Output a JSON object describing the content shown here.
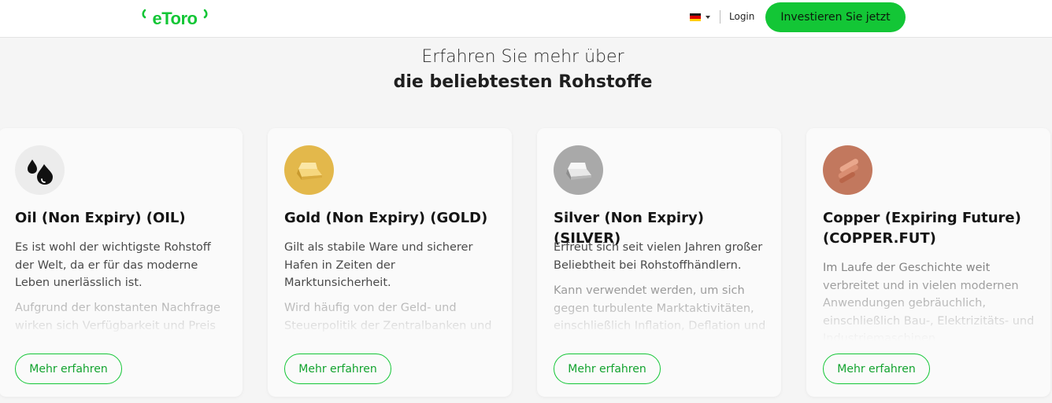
{
  "header": {
    "logo_text": "eToro",
    "language_flag": "de-flag",
    "login_label": "Login",
    "cta_label": "Investieren Sie jetzt",
    "accent_color": "#13c636"
  },
  "section": {
    "heading_line1": "Erfahren Sie mehr über",
    "heading_line2": "die beliebtesten Rohstoffe"
  },
  "cards": [
    {
      "icon": "oil-drops-icon",
      "title": "Oil (Non Expiry) (OIL)",
      "text": "Es ist wohl der wichtigste Rohstoff der Welt, da er für das moderne Leben unerlässlich ist.",
      "faded_text": "Aufgrund der konstanten Nachfrage wirken sich Verfügbarkeit und Preis",
      "button": "Mehr erfahren"
    },
    {
      "icon": "gold-bar-icon",
      "title": "Gold (Non Expiry) (GOLD)",
      "text": "Gilt als stabile Ware und sicherer Hafen in Zeiten der Marktunsicherheit.",
      "faded_text": "Wird häufig von der Geld- und Steuerpolitik der Zentralbanken und",
      "button": "Mehr erfahren"
    },
    {
      "icon": "silver-bar-icon",
      "title": "Silver (Non Expiry) (SILVER)",
      "text": "Erfreut sich seit vielen Jahren großer Beliebtheit bei Rohstoffhändlern.",
      "faded_text": "Kann verwendet werden, um sich gegen turbulente Marktaktivitäten, einschließlich Inflation, Deflation und",
      "button": "Mehr erfahren"
    },
    {
      "icon": "copper-pipes-icon",
      "title": "Copper (Expiring Future) (COPPER.FUT)",
      "text": "",
      "faded_text": "Im Laufe der Geschichte weit verbreitet und in vielen modernen Anwendungen gebräuchlich, einschließlich Bau-, Elektrizitäts- und Industriemaschinen",
      "button": "Mehr erfahren"
    }
  ]
}
